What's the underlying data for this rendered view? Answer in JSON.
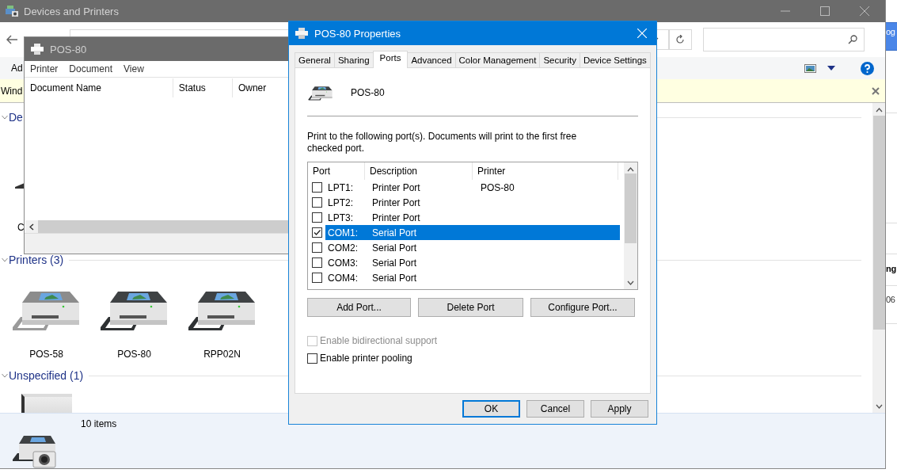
{
  "background_window": {
    "header_button": "og",
    "column_heading": "ng",
    "cell": "06"
  },
  "explorer": {
    "title": "Devices and Printers",
    "toolbar": {
      "command": "Ad"
    },
    "info_bar": {
      "text": "Wind"
    },
    "sections": [
      {
        "title": "De",
        "expanded": true,
        "items": [
          {
            "label": "C",
            "kind": "computer"
          }
        ]
      },
      {
        "title": "Printers (3)",
        "expanded": true,
        "items": [
          {
            "label": "POS-58",
            "kind": "printer-light"
          },
          {
            "label": "POS-80",
            "kind": "printer"
          },
          {
            "label": "RPP02N",
            "kind": "printer"
          }
        ]
      },
      {
        "title": "Unspecified (1)",
        "expanded": true,
        "items": [
          {
            "kind": "device"
          }
        ]
      }
    ],
    "details": {
      "count": "10 items"
    }
  },
  "print_queue": {
    "title": "POS-80",
    "menu": [
      "Printer",
      "Document",
      "View"
    ],
    "columns": [
      "Document Name",
      "Status",
      "Owner"
    ]
  },
  "dialog": {
    "title": "POS-80 Properties",
    "tabs": [
      {
        "label": "General",
        "selected": false
      },
      {
        "label": "Sharing",
        "selected": false
      },
      {
        "label": "Ports",
        "selected": true
      },
      {
        "label": "Advanced",
        "selected": false
      },
      {
        "label": "Color Management",
        "selected": false
      },
      {
        "label": "Security",
        "selected": false
      },
      {
        "label": "Device Settings",
        "selected": false
      }
    ],
    "printer_name": "POS-80",
    "description": "Print to the following port(s). Documents will print to the first free checked port.",
    "ports": {
      "columns": [
        "Port",
        "Description",
        "Printer"
      ],
      "rows": [
        {
          "port": "LPT1:",
          "description": "Printer Port",
          "printer": "POS-80",
          "checked": false,
          "selected": false
        },
        {
          "port": "LPT2:",
          "description": "Printer Port",
          "checked": false,
          "selected": false
        },
        {
          "port": "LPT3:",
          "description": "Printer Port",
          "checked": false,
          "selected": false
        },
        {
          "port": "COM1:",
          "description": "Serial Port",
          "checked": true,
          "selected": true
        },
        {
          "port": "COM2:",
          "description": "Serial Port",
          "checked": false,
          "selected": false
        },
        {
          "port": "COM3:",
          "description": "Serial Port",
          "checked": false,
          "selected": false
        },
        {
          "port": "COM4:",
          "description": "Serial Port",
          "checked": false,
          "selected": false
        }
      ]
    },
    "port_buttons": [
      "Add Port...",
      "Delete Port",
      "Configure Port..."
    ],
    "options": [
      {
        "label": "Enable bidirectional support",
        "checked": false,
        "disabled": true
      },
      {
        "label": "Enable printer pooling",
        "checked": false,
        "disabled": false
      }
    ],
    "buttons": [
      {
        "label": "OK",
        "default": true
      },
      {
        "label": "Cancel",
        "default": false
      },
      {
        "label": "Apply",
        "default": false
      }
    ]
  }
}
